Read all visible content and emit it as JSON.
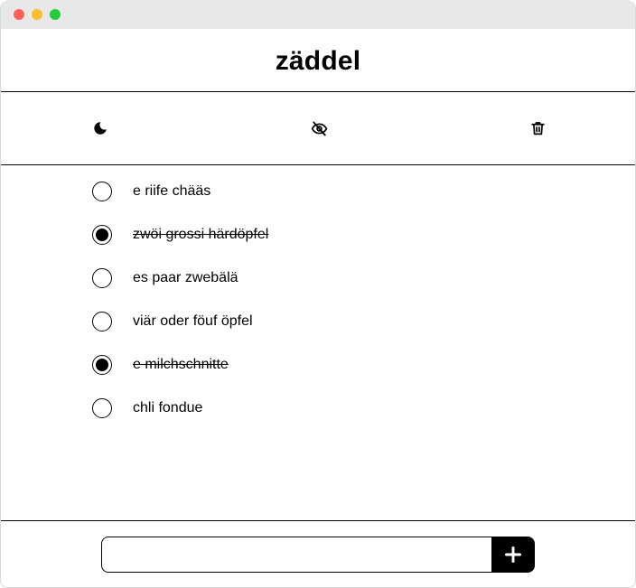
{
  "app": {
    "title": "zäddel"
  },
  "toolbar": {
    "theme_icon": "moon-icon",
    "hide_icon": "eye-off-icon",
    "delete_icon": "trash-icon"
  },
  "todos": [
    {
      "label": "e riife chääs",
      "done": false
    },
    {
      "label": "zwöi grossi härdöpfel",
      "done": true
    },
    {
      "label": "es paar zwebälä",
      "done": false
    },
    {
      "label": "viär oder föuf öpfel",
      "done": false
    },
    {
      "label": "e milchschnitte",
      "done": true
    },
    {
      "label": "chli fondue",
      "done": false
    }
  ],
  "footer": {
    "input_value": "",
    "input_placeholder": "",
    "add_icon": "plus-icon"
  }
}
